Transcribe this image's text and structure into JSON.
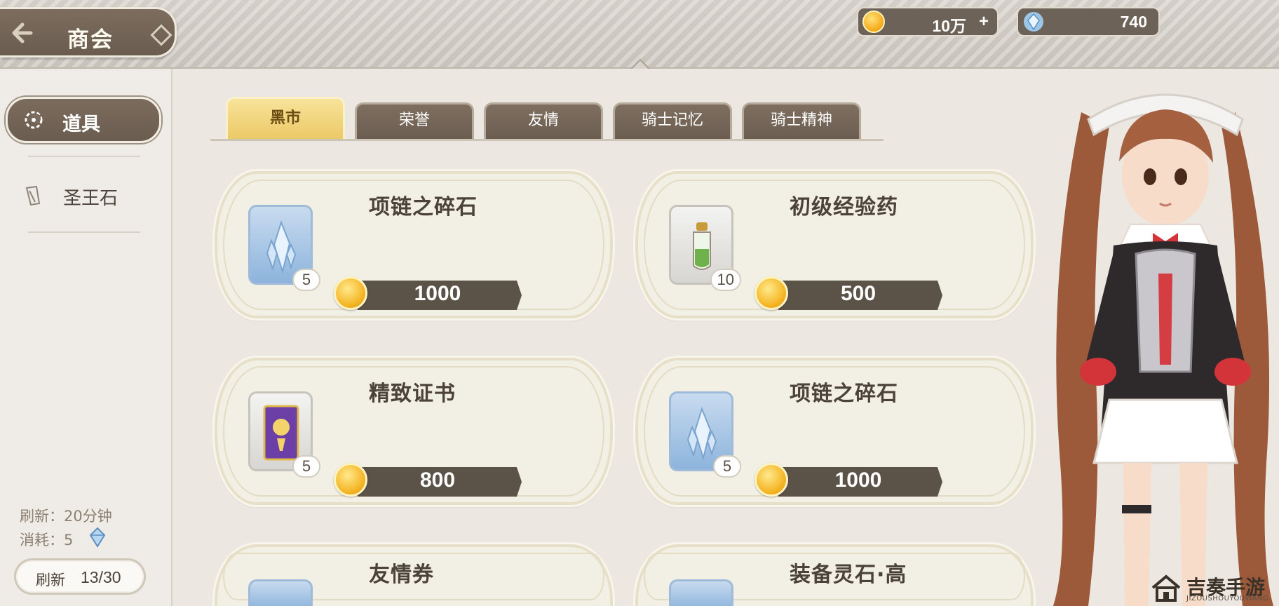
{
  "header": {
    "title": "商会",
    "gold": {
      "value": "10万",
      "plus": "+"
    },
    "gems": {
      "value": "740"
    }
  },
  "sidebar": {
    "items": [
      {
        "label": "道具",
        "active": true
      },
      {
        "label": "圣王石",
        "active": false
      }
    ],
    "refresh_time": "刷新：20分钟",
    "cost_text": "消耗：5",
    "refresh_button": {
      "label": "刷新",
      "count": "13/30"
    }
  },
  "tabs": [
    {
      "label": "黑市",
      "active": true
    },
    {
      "label": "荣誉",
      "active": false
    },
    {
      "label": "友情",
      "active": false
    },
    {
      "label": "骑士记忆",
      "active": false
    },
    {
      "label": "骑士精神",
      "active": false
    }
  ],
  "items": [
    {
      "name": "项链之碎石",
      "qty": "5",
      "price": "1000",
      "icon": "crystal-shard-icon"
    },
    {
      "name": "初级经验药",
      "qty": "10",
      "price": "500",
      "icon": "potion-icon"
    },
    {
      "name": "精致证书",
      "qty": "5",
      "price": "800",
      "icon": "certificate-icon"
    },
    {
      "name": "项链之碎石",
      "qty": "5",
      "price": "1000",
      "icon": "crystal-shard-icon"
    },
    {
      "name": "友情券",
      "qty": "",
      "price": "",
      "icon": "ticket-icon"
    },
    {
      "name": "装备灵石·高",
      "qty": "",
      "price": "",
      "icon": "spirit-stone-icon"
    }
  ],
  "watermark": {
    "text": "吉奏手游网",
    "sub": "JIZOUSHOUYOUWANG"
  },
  "colors": {
    "accent_gold": "#ecc966",
    "panel_brown": "#6b5d50",
    "price_bar": "#5c5348"
  }
}
